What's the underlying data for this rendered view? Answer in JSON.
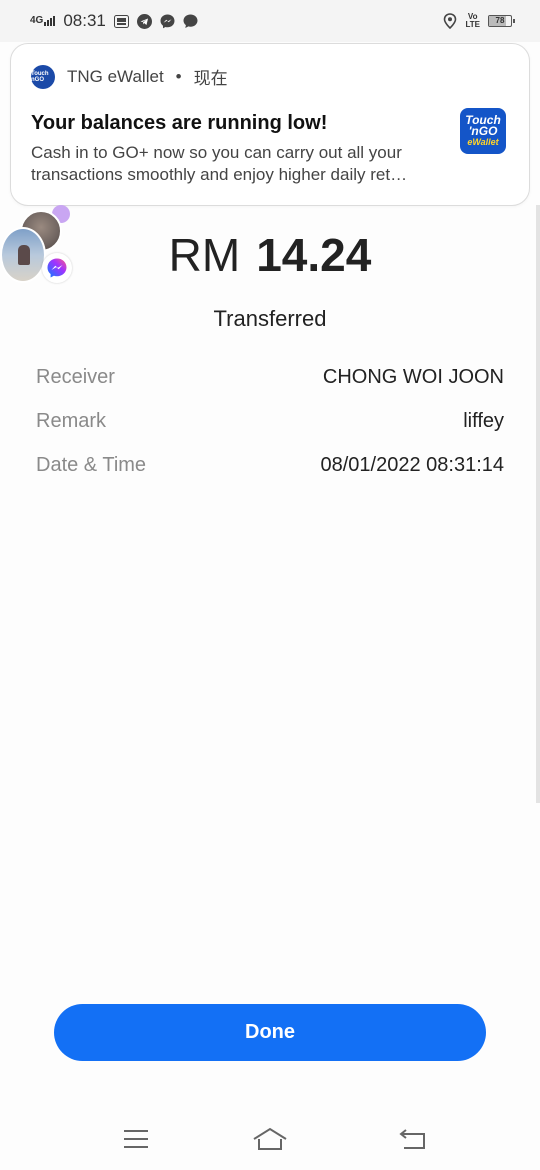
{
  "status_bar": {
    "network": "4G",
    "time": "08:31",
    "volte": "Vo\nLTE",
    "battery": "78",
    "icons": [
      "tng-notification-icon",
      "telegram-icon",
      "messenger-icon",
      "chat-bubble-icon",
      "location-icon"
    ]
  },
  "notification": {
    "app_name": "TNG eWallet",
    "separator": "•",
    "time": "现在",
    "title": "Your balances are running low!",
    "body_line1": "Cash in to GO+ now so you can carry out all your",
    "body_line2": "transactions smoothly and enjoy higher daily ret…",
    "logo_line1": "Touch",
    "logo_line2": "'nGO",
    "logo_line3": "eWallet",
    "logo_small": "Touch nGO"
  },
  "transaction": {
    "currency": "RM",
    "amount": "14.24",
    "status": "Transferred",
    "details": [
      {
        "label": "Receiver",
        "value": "CHONG WOI JOON"
      },
      {
        "label": "Remark",
        "value": "liffey"
      },
      {
        "label": "Date & Time",
        "value": "08/01/2022 08:31:14"
      }
    ]
  },
  "actions": {
    "done_label": "Done"
  },
  "colors": {
    "primary": "#1370f5",
    "label_gray": "#8a8a8a",
    "logo_blue": "#1455c8"
  },
  "nav_bar": {
    "icons": [
      "menu-icon",
      "home-icon",
      "back-icon"
    ]
  }
}
